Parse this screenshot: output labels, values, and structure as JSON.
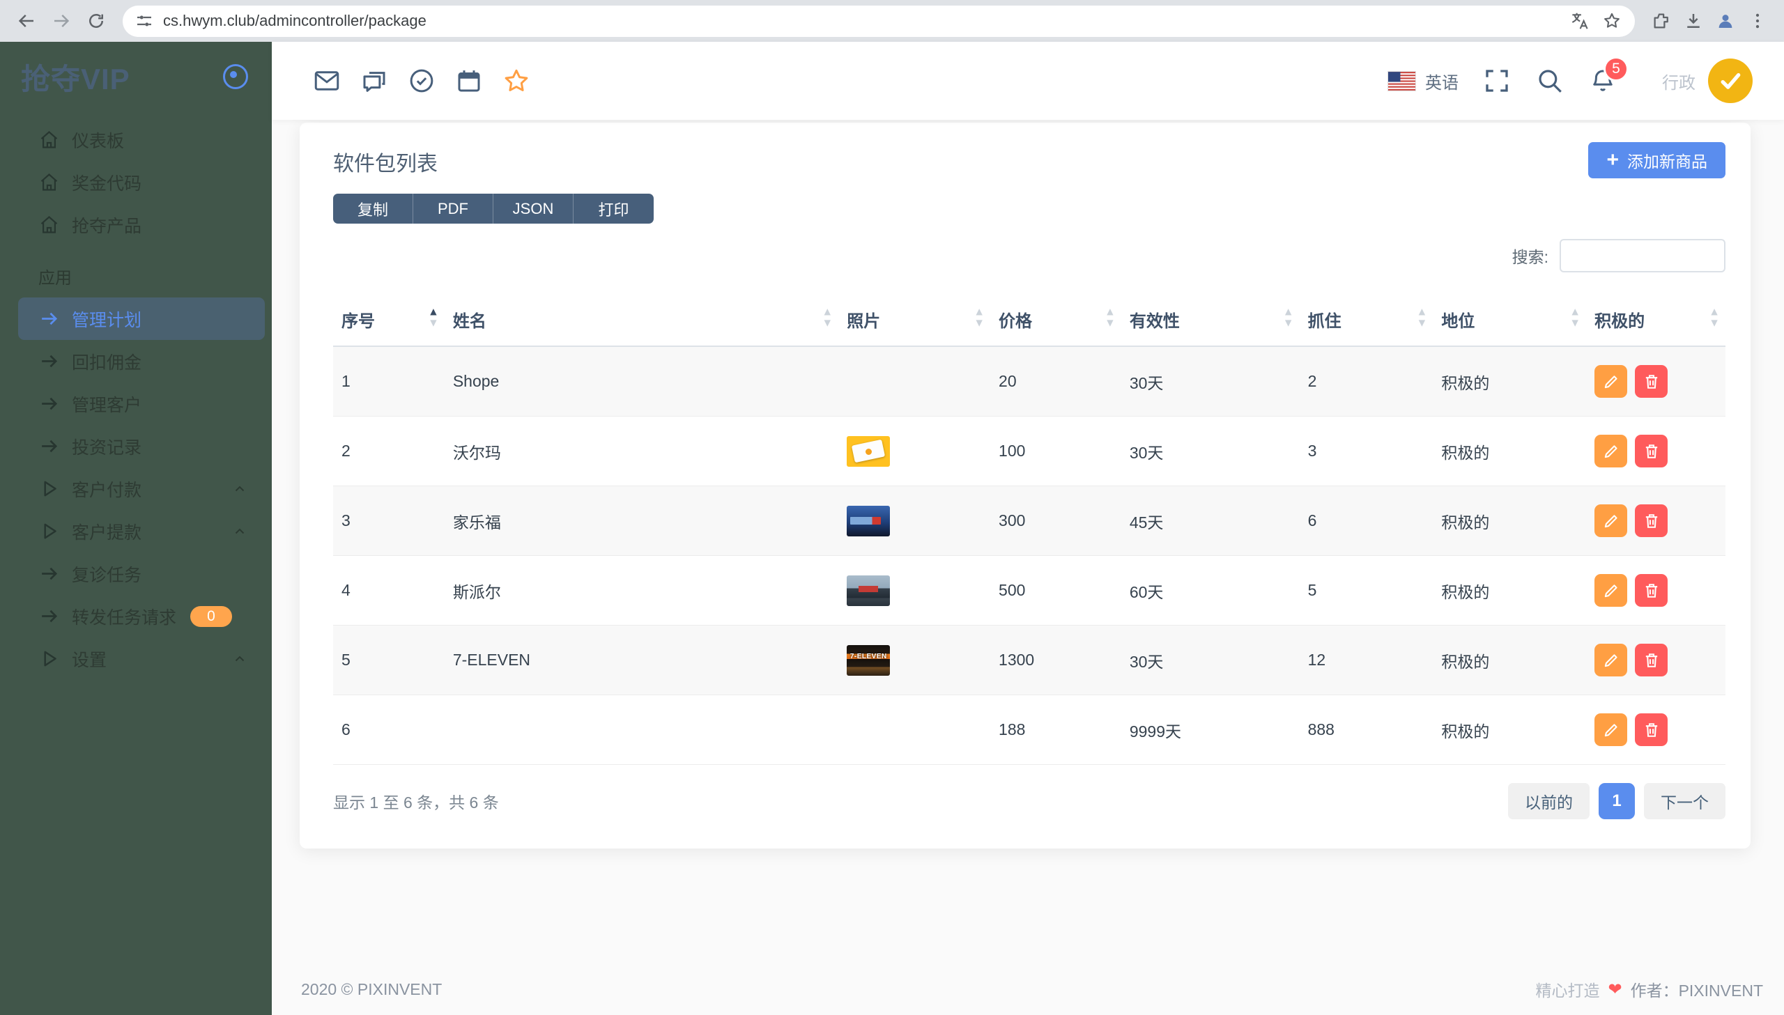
{
  "browser": {
    "url": "cs.hwym.club/admincontroller/package"
  },
  "sidebar": {
    "brand": "抢夺VIP",
    "items": [
      {
        "type": "link",
        "label": "仪表板",
        "icon": "home"
      },
      {
        "type": "link",
        "label": "奖金代码",
        "icon": "home"
      },
      {
        "type": "link",
        "label": "抢夺产品",
        "icon": "home"
      },
      {
        "type": "section",
        "label": "应用"
      },
      {
        "type": "link",
        "label": "管理计划",
        "icon": "arrow",
        "active": true
      },
      {
        "type": "link",
        "label": "回扣佣金",
        "icon": "arrow"
      },
      {
        "type": "link",
        "label": "管理客户",
        "icon": "arrow"
      },
      {
        "type": "link",
        "label": "投资记录",
        "icon": "arrow"
      },
      {
        "type": "link",
        "label": "客户付款",
        "icon": "play",
        "chevron": true
      },
      {
        "type": "link",
        "label": "客户提款",
        "icon": "play",
        "chevron": true
      },
      {
        "type": "link",
        "label": "复诊任务",
        "icon": "arrow"
      },
      {
        "type": "link",
        "label": "转发任务请求",
        "icon": "arrow",
        "badge": "0"
      },
      {
        "type": "link",
        "label": "设置",
        "icon": "play",
        "chevron": true
      }
    ]
  },
  "header": {
    "language": "英语",
    "notification_count": "5",
    "user_name": "行政"
  },
  "page": {
    "card_title": "软件包列表",
    "export_buttons": [
      "复制",
      "PDF",
      "JSON",
      "打印"
    ],
    "add_button_label": "添加新商品",
    "search_label": "搜索:",
    "search_value": "",
    "table": {
      "columns": [
        {
          "label": "序号",
          "sort": "asc"
        },
        {
          "label": "姓名"
        },
        {
          "label": "照片"
        },
        {
          "label": "价格"
        },
        {
          "label": "有效性"
        },
        {
          "label": "抓住"
        },
        {
          "label": "地位"
        },
        {
          "label": "积极的"
        }
      ],
      "rows": [
        {
          "no": "1",
          "name": "Shope",
          "photo": "",
          "price": "20",
          "validity": "30天",
          "grab": "2",
          "status": "积极的"
        },
        {
          "no": "2",
          "name": "沃尔玛",
          "photo": "walmart",
          "price": "100",
          "validity": "30天",
          "grab": "3",
          "status": "积极的"
        },
        {
          "no": "3",
          "name": "家乐福",
          "photo": "carrefour",
          "price": "300",
          "validity": "45天",
          "grab": "6",
          "status": "积极的"
        },
        {
          "no": "4",
          "name": "斯派尔",
          "photo": "spar",
          "price": "500",
          "validity": "60天",
          "grab": "5",
          "status": "积极的"
        },
        {
          "no": "5",
          "name": "7-ELEVEN",
          "photo": "seven",
          "price": "1300",
          "validity": "30天",
          "grab": "12",
          "status": "积极的"
        },
        {
          "no": "6",
          "name": "",
          "photo": "",
          "price": "188",
          "validity": "9999天",
          "grab": "888",
          "status": "积极的"
        }
      ]
    },
    "info_text": "显示 1 至 6 条，共 6 条",
    "pagination": {
      "prev_label": "以前的",
      "page": "1",
      "next_label": "下一个"
    }
  },
  "footer": {
    "left": "2020 © PIXINVENT",
    "right_prefix": "精心打造",
    "heart": "❤",
    "right_author": "作者：PIXINVENT"
  },
  "colors": {
    "accent_blue": "#5a8dee",
    "sidebar_green": "#41564a",
    "warning_orange": "#ff9f43",
    "danger_red": "#ff5b5c",
    "slate": "#475f7b"
  }
}
